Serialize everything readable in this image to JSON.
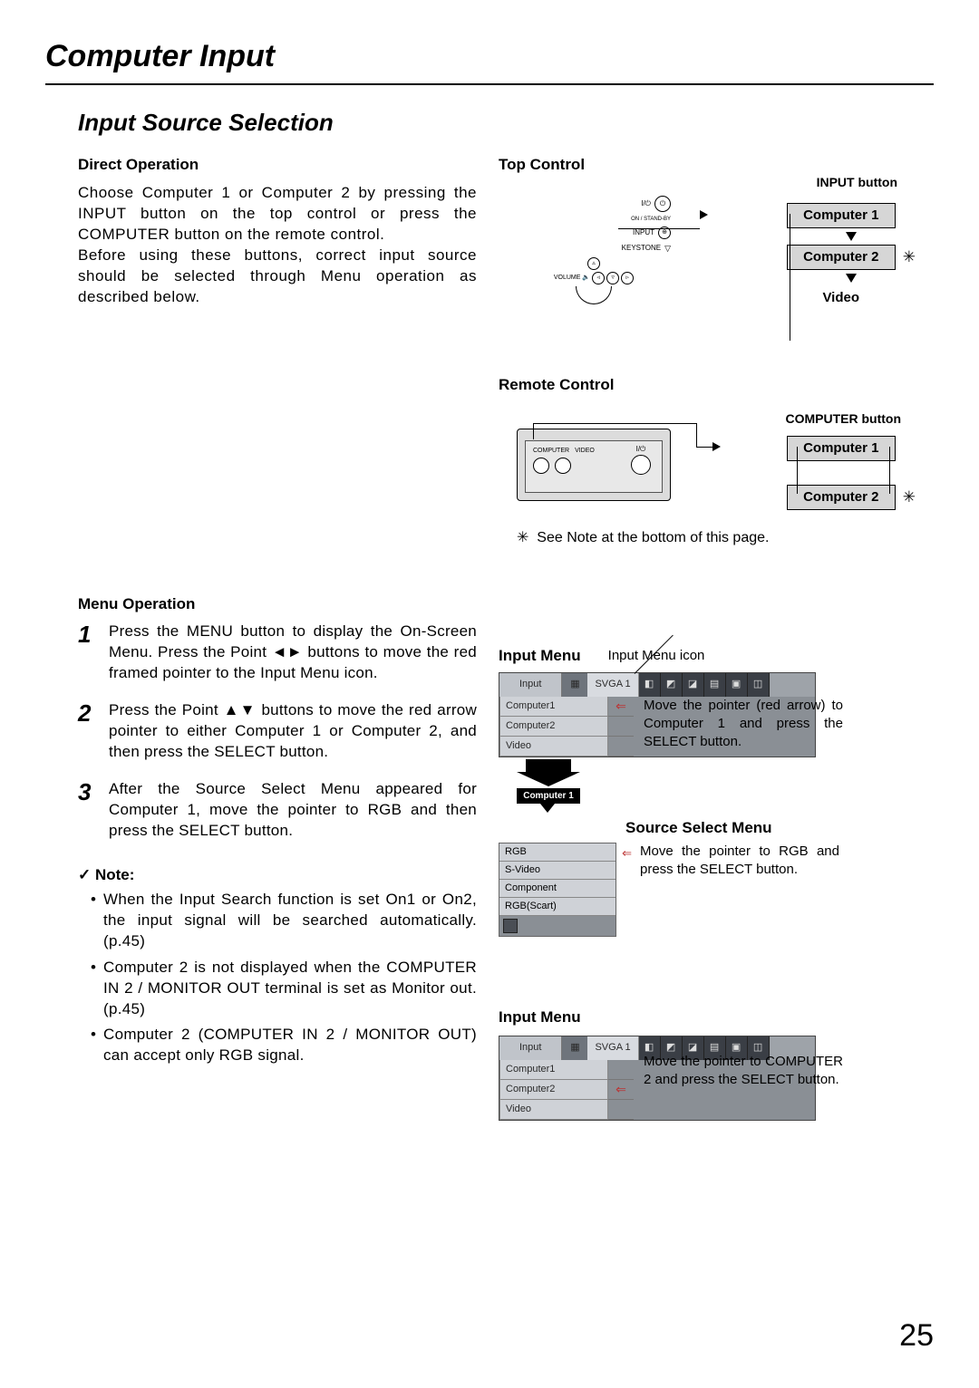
{
  "page_title": "Computer Input",
  "section_title": "Input Source Selection",
  "page_number": "25",
  "direct_op": {
    "heading": "Direct Operation",
    "p1": "Choose Computer 1 or Computer 2 by pressing the INPUT button on the top control or press the COMPUTER button on the remote control.",
    "p2": "Before using these buttons, correct input source should be selected through Menu operation as described below."
  },
  "top_control": {
    "heading": "Top Control",
    "btn_label": "INPUT button",
    "panel": {
      "standby": "ON / STAND-BY",
      "power_sym": "I/⏻",
      "input": "INPUT",
      "keystone": "KEYSTONE",
      "volume": "VOLUME"
    },
    "cycle": {
      "c1": "Computer 1",
      "c2": "Computer 2",
      "video": "Video"
    }
  },
  "remote": {
    "heading": "Remote Control",
    "btn_label": "COMPUTER button",
    "labels": {
      "computer": "COMPUTER",
      "video": "VIDEO",
      "power": "I/⏻"
    },
    "cycle": {
      "c1": "Computer 1",
      "c2": "Computer 2"
    }
  },
  "ast_symbol": "✳",
  "ast_note": "See Note at the bottom of this page.",
  "menu_op": {
    "heading": "Menu Operation",
    "steps": {
      "s1": "Press the MENU button to display the On-Screen Menu.  Press the Point ◄► buttons to move the red framed pointer to the Input Menu icon.",
      "s2": "Press the Point ▲▼ buttons to move the red arrow pointer to either Computer 1 or Computer 2, and then press the SELECT button.",
      "s3": "After the Source Select Menu appeared for Computer 1, move the pointer to RGB and then press the SELECT button."
    }
  },
  "note": {
    "heading": "✓ Note:",
    "n1": "When the Input Search function is set On1 or On2, the input signal will be searched automatically. (p.45)",
    "n2": "Computer 2 is not displayed when the COMPUTER IN 2 / MONITOR OUT terminal is set as Monitor out. (p.45)",
    "n3": "Computer 2 (COMPUTER IN 2 / MONITOR OUT) can accept only RGB signal."
  },
  "input_menu": {
    "heading": "Input Menu",
    "icon_label": "Input Menu icon",
    "tab": "Input",
    "mode": "SVGA 1",
    "rows": {
      "r1": "Computer1",
      "r2": "Computer2",
      "r3": "Video"
    },
    "caption1": "Move the pointer (red arrow) to Computer 1 and press the SELECT button.",
    "badge": "Computer 1"
  },
  "source_menu": {
    "heading": "Source Select Menu",
    "rows": {
      "r1": "RGB",
      "r2": "S-Video",
      "r3": "Component",
      "r4": "RGB(Scart)"
    },
    "caption": "Move the pointer to RGB and press the SELECT button."
  },
  "input_menu2": {
    "heading": "Input Menu",
    "caption": "Move the pointer to COMPUTER 2 and press the SELECT button."
  }
}
